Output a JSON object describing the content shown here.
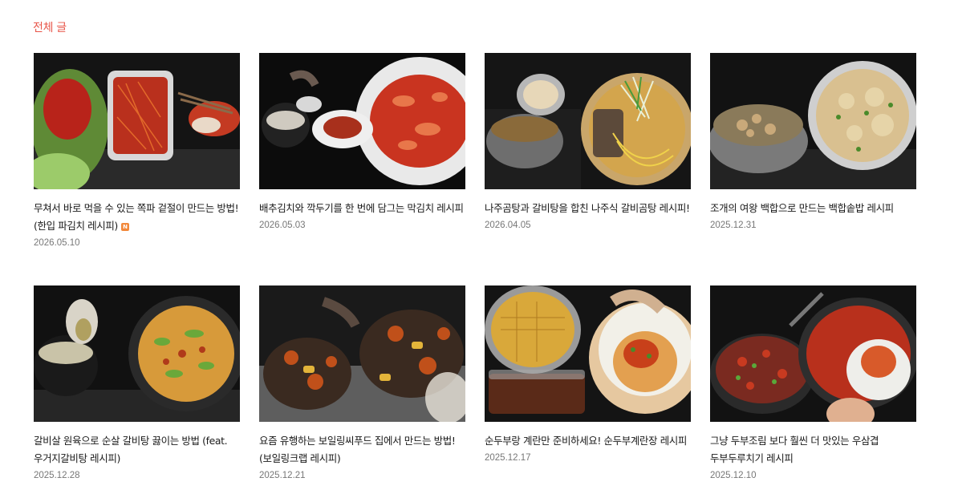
{
  "section": {
    "title": "전체 글"
  },
  "posts": [
    {
      "title": "무쳐서 바로 먹을 수 있는 쪽파 겉절이 만드는 방법! (한입 파김치 레시피)",
      "date": "2026.05.10",
      "badge": "N"
    },
    {
      "title": "배추김치와 깍두기를 한 번에 담그는 막김치 레시피",
      "date": "2026.05.03"
    },
    {
      "title": "나주곰탕과 갈비탕을 합친 나주식 갈비곰탕 레시피!",
      "date": "2026.04.05"
    },
    {
      "title": "조개의 여왕 백합으로 만드는 백합솥밥 레시피",
      "date": "2025.12.31"
    },
    {
      "title": "갈비살 원육으로 순살 갈비탕 끓이는 방법 (feat. 우거지갈비탕 레시피)",
      "date": "2025.12.28"
    },
    {
      "title": "요즘 유행하는 보일링씨푸드 집에서 만드는 방법! (보일링크랩 레시피)",
      "date": "2025.12.21"
    },
    {
      "title": "순두부랑 계란만 준비하세요! 순두부계란장 레시피",
      "date": "2025.12.17"
    },
    {
      "title": "그냥 두부조림 보다 훨씬 더 맛있는 우삼겹 두부두루치기 레시피",
      "date": "2025.12.10"
    }
  ],
  "colors": {
    "accent": "#e8564a",
    "badge": "#f2883a",
    "date": "#777777"
  }
}
